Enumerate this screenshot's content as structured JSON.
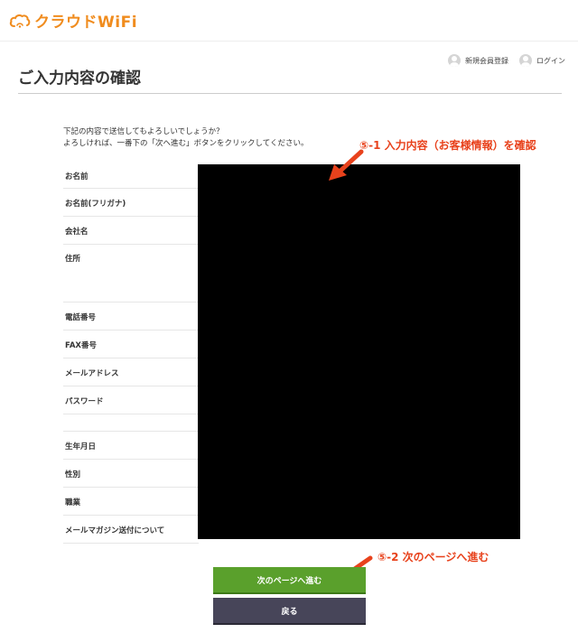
{
  "header": {
    "logo_text": "クラウドWiFi"
  },
  "top_links": {
    "register": "新規会員登録",
    "login": "ログイン"
  },
  "page_title": "ご入力内容の確認",
  "intro": {
    "line1": "下記の内容で送信してもよろしいでしょうか？",
    "line2": "よろしければ、一番下の「次へ進む」ボタンをクリックしてください。"
  },
  "fields": [
    "お名前",
    "お名前(フリガナ)",
    "会社名",
    "住所",
    "電話番号",
    "FAX番号",
    "メールアドレス",
    "パスワード",
    "",
    "生年月日",
    "性別",
    "職業",
    "メールマガジン送付について"
  ],
  "annotations": {
    "step1": "⑤-1 入力内容（お客様情報）を確認",
    "step2": "⑤-2 次のページへ進む"
  },
  "buttons": {
    "next": "次のページへ進む",
    "back": "戻る"
  },
  "colors": {
    "brand": "#f08c1e",
    "next_button": "#5aa02c",
    "back_button": "#474559",
    "annotation": "#e8421c"
  }
}
